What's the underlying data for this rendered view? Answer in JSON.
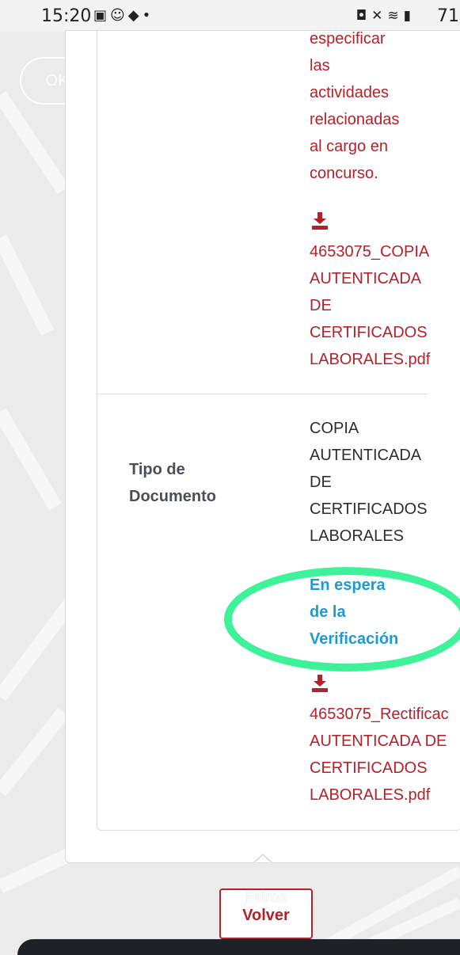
{
  "status_bar": {
    "time": "15:20",
    "battery": "71"
  },
  "dialog": {
    "ok_label": "OK"
  },
  "content": {
    "description_lines": [
      "especificar",
      "las",
      "actividades",
      "relacionadas",
      "al cargo en",
      "concurso."
    ],
    "file_1_lines": [
      "4653075_COPIA",
      "AUTENTICADA",
      "DE",
      "CERTIFICADOS",
      "LABORALES.pdf"
    ],
    "doc_type_label_lines": [
      "Tipo de",
      "Documento"
    ],
    "doc_type_value_lines": [
      "COPIA",
      "AUTENTICADA",
      "DE",
      "CERTIFICADOS",
      "LABORALES"
    ],
    "status_lines": [
      "En espera",
      "de la",
      "Verificación"
    ],
    "file_2_lines": [
      "4653075_Rectificac",
      "AUTENTICADA DE",
      "CERTIFICADOS",
      "LABORALES.pdf"
    ]
  },
  "footer": {
    "filters_label": "Filtros",
    "back_label": "Volver"
  },
  "colors": {
    "link_red": "#b52129",
    "status_blue": "#1d9ad6",
    "highlight_green": "#3ef29a"
  },
  "icons": [
    "image-icon",
    "avatar-icon",
    "app-icon",
    "download-icon",
    "chevron-up-icon"
  ]
}
